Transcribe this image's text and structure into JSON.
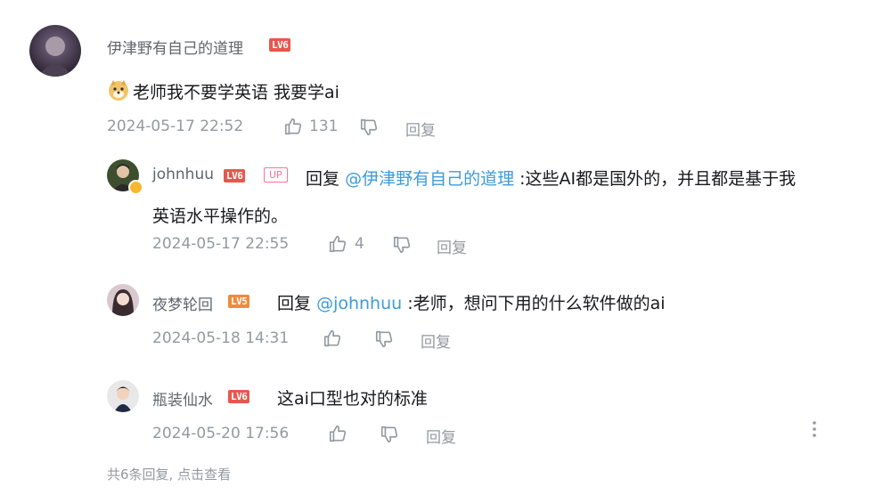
{
  "main_comment": {
    "username": "伊津野有自己的道理",
    "level": "LV6",
    "content": "老师我不要学英语 我要学ai",
    "time": "2024-05-17 22:52",
    "likes": "131",
    "reply_label": "回复"
  },
  "replies": [
    {
      "username": "johnhuu",
      "level": "LV6",
      "badge": "UP",
      "reply_prefix": "回复",
      "mention": "@伊津野有自己的道理",
      "content_line1": ":这些AI都是国外的，并且都是基于我",
      "content_line2": "英语水平操作的。",
      "time": "2024-05-17 22:55",
      "likes": "4",
      "reply_label": "回复"
    },
    {
      "username": "夜梦轮回",
      "level": "LV5",
      "reply_prefix": "回复",
      "mention": "@johnhuu",
      "content": ":老师，想问下用的什么软件做的ai",
      "time": "2024-05-18 14:31",
      "reply_label": "回复"
    },
    {
      "username": "瓶装仙水",
      "level": "LV6",
      "content": "这ai口型也对的标准",
      "time": "2024-05-20 17:56",
      "reply_label": "回复"
    }
  ],
  "footer": {
    "summary": "共6条回复, 点击查看"
  },
  "icons": {
    "like": "thumbs-up-icon",
    "dislike": "thumbs-down-icon",
    "more": "more-vertical-icon",
    "emoji": "doge-emoji-icon"
  },
  "colors": {
    "level6": "#e5584e",
    "level5": "#f08a3c",
    "up_badge": "#fb7299",
    "mention": "#3d9bd8",
    "meta": "#9499a0"
  }
}
